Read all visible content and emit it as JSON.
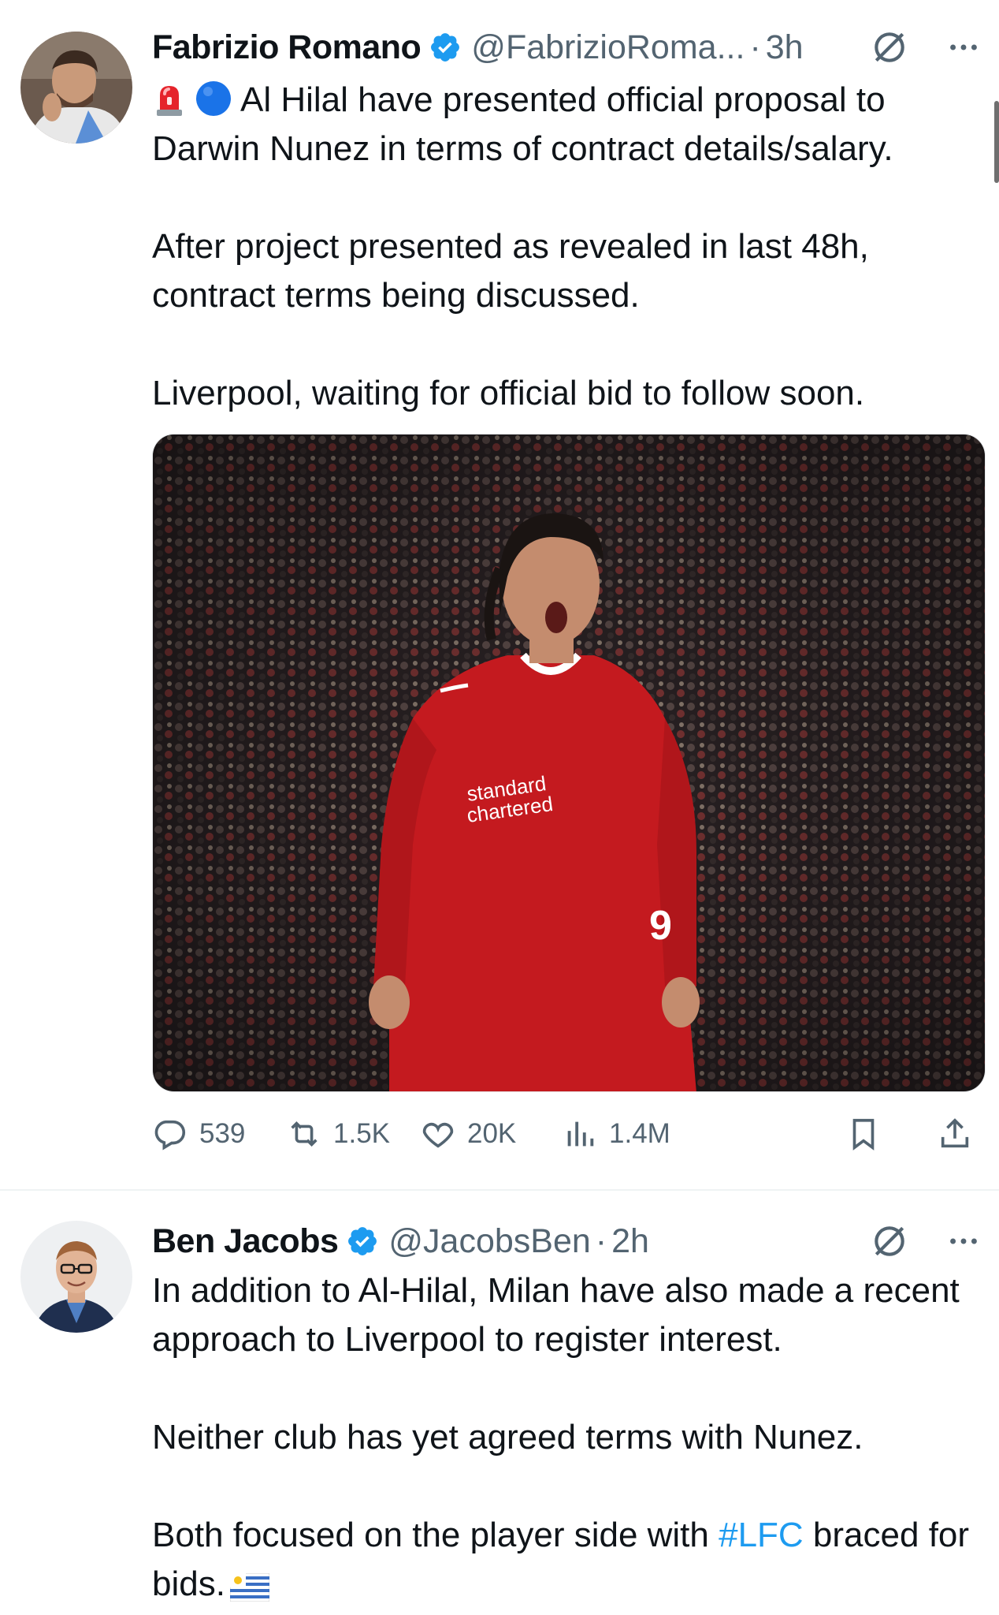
{
  "tweets": [
    {
      "author_name": "Fabrizio Romano",
      "handle": "@FabrizioRoma...",
      "separator": "·",
      "time": "3h",
      "text_line_1": "Al Hilal have presented official proposal to Darwin Nunez in terms of contract details/salary.",
      "text_para_2": "After project presented as revealed in last 48h, contract terms being discussed.",
      "text_para_3": "Liverpool, waiting for official bid to follow soon.",
      "media_alt": "Darwin Nunez celebrating in Liverpool kit",
      "metrics": {
        "replies": "539",
        "reposts": "1.5K",
        "likes": "20K",
        "views": "1.4M"
      },
      "icons": [
        "verified-badge-icon",
        "grok-icon",
        "more-icon",
        "siren-emoji",
        "blue-circle-emoji",
        "reply-icon",
        "repost-icon",
        "like-icon",
        "views-icon",
        "bookmark-icon",
        "share-icon"
      ]
    },
    {
      "author_name": "Ben Jacobs",
      "handle": "@JacobsBen",
      "separator": "·",
      "time": "2h",
      "text_para_1": "In addition to Al-Hilal, Milan have also made a recent approach to Liverpool to register interest.",
      "text_para_2": "Neither club has yet agreed terms with Nunez.",
      "text_para_3_start": "Both focused on the player side with ",
      "hashtag": "#LFC",
      "text_para_3_end": " braced for bids.",
      "icons": [
        "verified-badge-icon",
        "grok-icon",
        "more-icon",
        "uruguay-flag-emoji"
      ]
    }
  ],
  "colors": {
    "text": "#0f1419",
    "secondary_text": "#536471",
    "verified_blue": "#1d9bf0",
    "hashtag": "#1d9bf0",
    "divider": "#eff3f4"
  }
}
